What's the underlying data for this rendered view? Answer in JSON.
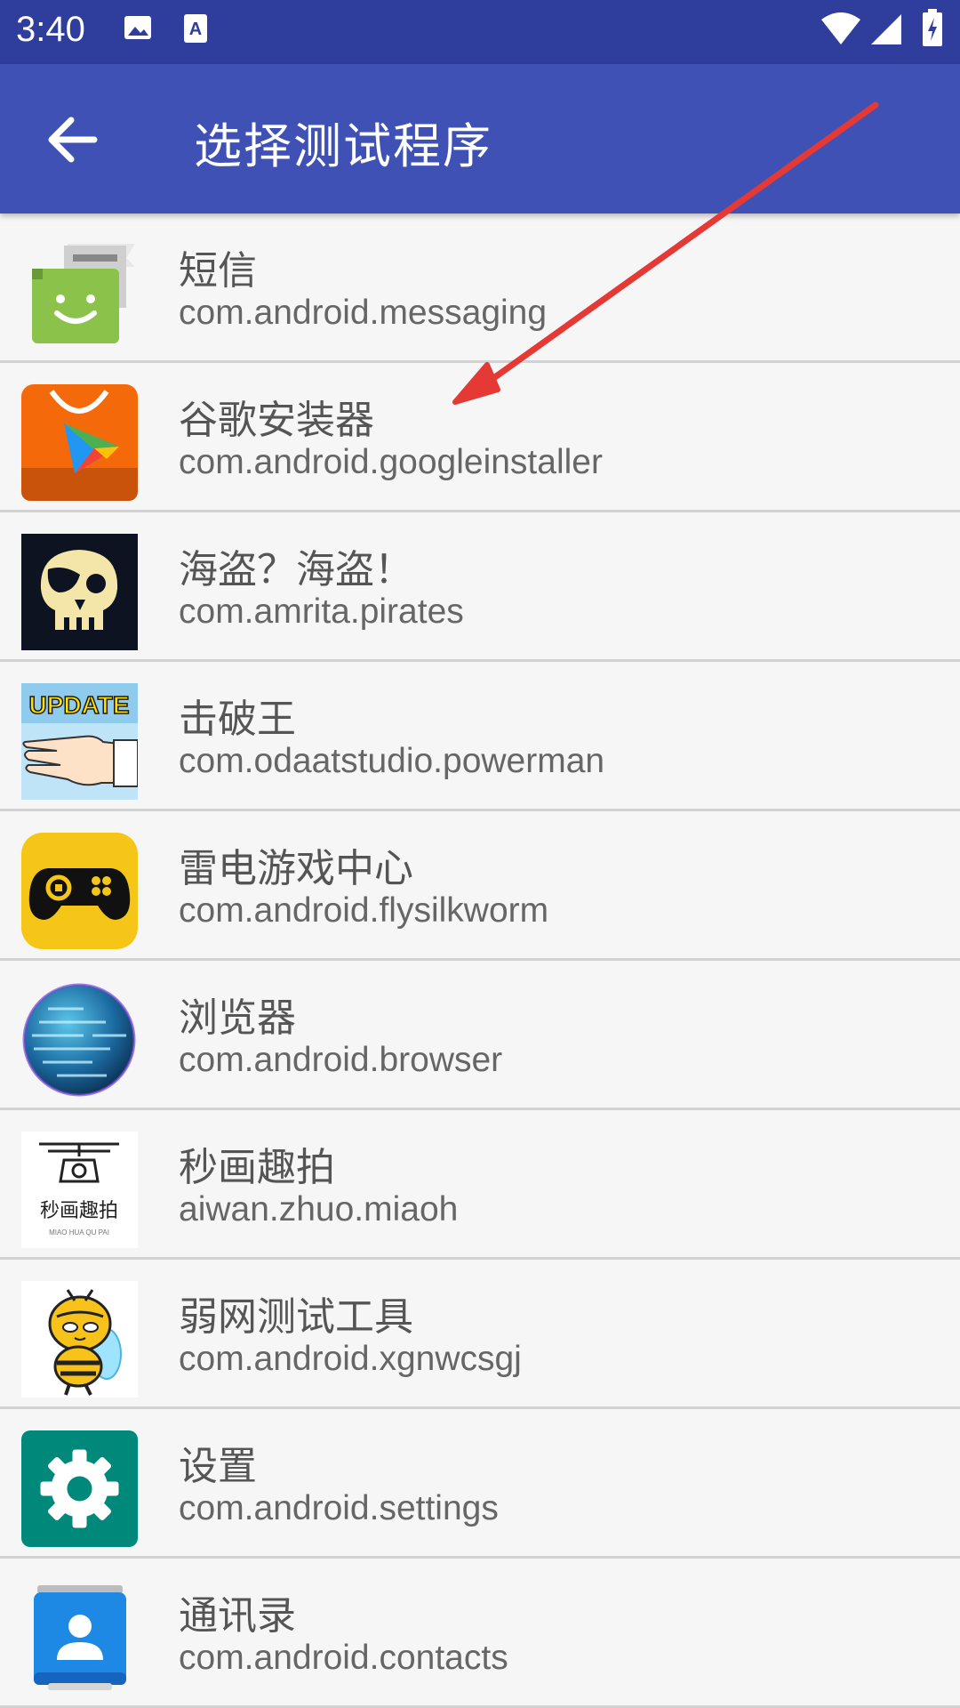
{
  "status_bar": {
    "time": "3:40",
    "icons": [
      "image-icon",
      "font-icon",
      "wifi-icon",
      "signal-icon",
      "battery-icon"
    ]
  },
  "app_bar": {
    "title": "选择测试程序",
    "back_icon": "arrow-left-icon",
    "color": "#3f51b5",
    "status_color": "#2f3d9c"
  },
  "apps": [
    {
      "name": "短信",
      "package": "com.android.messaging",
      "icon": "messaging-icon"
    },
    {
      "name": "谷歌安装器",
      "package": "com.android.googleinstaller",
      "icon": "google-installer-icon"
    },
    {
      "name": "海盗？海盗！",
      "package": "com.amrita.pirates",
      "icon": "pirate-skull-icon"
    },
    {
      "name": "击破王",
      "package": "com.odaatstudio.powerman",
      "icon": "update-hand-icon"
    },
    {
      "name": "雷电游戏中心",
      "package": "com.android.flysilkworm",
      "icon": "gamepad-icon"
    },
    {
      "name": "浏览器",
      "package": "com.android.browser",
      "icon": "globe-icon"
    },
    {
      "name": "秒画趣拍",
      "package": "aiwan.zhuo.miaoh",
      "icon": "drone-camera-icon",
      "icon_text": "秒画趣拍",
      "icon_subtext": "MIAO HUA QU PAI"
    },
    {
      "name": "弱网测试工具",
      "package": "com.android.xgnwcsgj",
      "icon": "bee-icon"
    },
    {
      "name": "设置",
      "package": "com.android.settings",
      "icon": "gear-icon"
    },
    {
      "name": "通讯录",
      "package": "com.android.contacts",
      "icon": "contacts-icon"
    }
  ],
  "icon_texts": {
    "update": "UPDATE"
  },
  "annotation": {
    "type": "red-arrow",
    "color": "#e53935"
  }
}
